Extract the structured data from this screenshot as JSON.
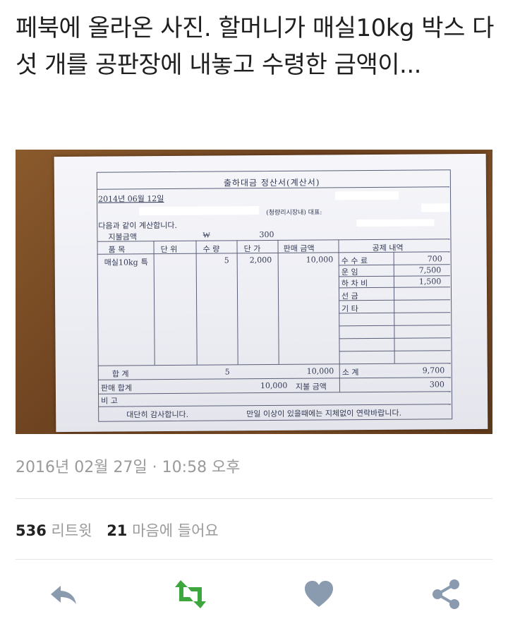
{
  "tweet": {
    "text": "페북에 올라온 사진. 할머니가 매실10kg 박스 다섯 개를 공판장에 내놓고 수령한 금액이...",
    "timestamp": "2016년 02월 27일 · 10:58 오후"
  },
  "receipt": {
    "title": "출하대금 정산서(계산서)",
    "date": "2014년 06월 12일",
    "market_label": "(청량리시장내) 대표:",
    "intro": "다음과 같이 계산합니다.",
    "payout_label": "지불금액",
    "payout_currency": "₩",
    "payout_value": "300",
    "headers": {
      "item": "품    목",
      "unit": "단 위",
      "qty": "수 량",
      "price": "단 가",
      "sales": "판매 금액",
      "deductions": "공제  내역"
    },
    "item": {
      "name": "매실10kg",
      "grade": "특",
      "qty": "5",
      "price": "2,000",
      "sales": "10,000"
    },
    "deduction_rows": [
      {
        "label": "수 수 료",
        "amount": "700"
      },
      {
        "label": "운    임",
        "amount": "7,500"
      },
      {
        "label": "하 차 비",
        "amount": "1,500"
      },
      {
        "label": "선    금",
        "amount": ""
      },
      {
        "label": "기    타",
        "amount": ""
      }
    ],
    "total_label": "합    계",
    "total_qty": "5",
    "total_sales": "10,000",
    "subtotal_label": "소    계",
    "subtotal_amount": "9,700",
    "sales_total_label": "판매 합계",
    "sales_total_value": "10,000",
    "payout_total_label": "지불 금액",
    "payout_total_value": "300",
    "remarks_label": "비    고",
    "thanks": "대단히 감사합니다.",
    "contact_note": "만일 이상이 있을때에는 지체없이 연락바랍니다."
  },
  "stats": {
    "retweets_count": "536",
    "retweets_label": "리트윗",
    "likes_count": "21",
    "likes_label": "마음에 들어요"
  },
  "icons": {
    "reply": "reply-icon",
    "retweet": "retweet-icon",
    "like": "heart-icon",
    "share": "share-icon"
  },
  "colors": {
    "action_gray": "#8a9bb0",
    "retweet_green": "#3ea63e",
    "meta_gray": "#9a9a9a"
  }
}
